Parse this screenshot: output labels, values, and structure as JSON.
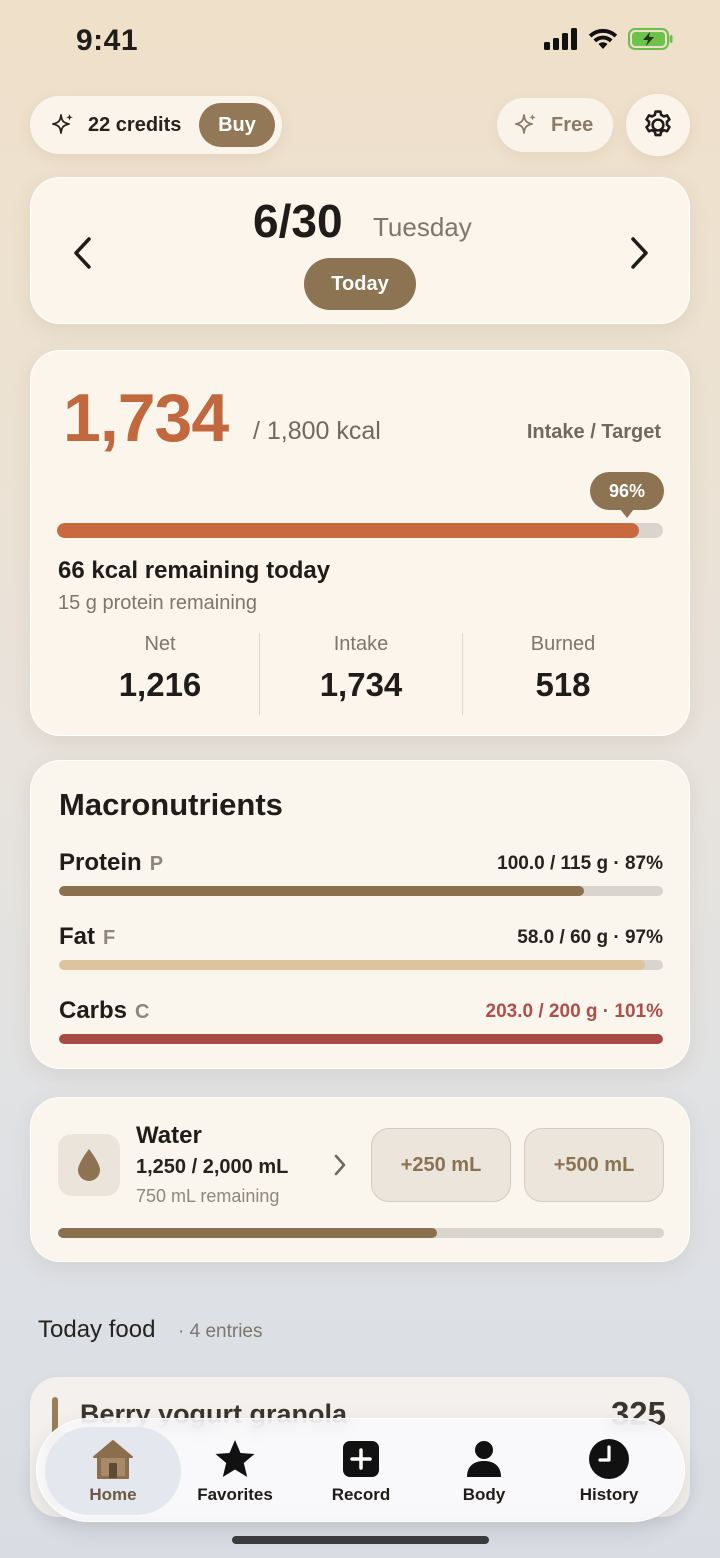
{
  "status_bar": {
    "time": "9:41"
  },
  "top": {
    "credits_label": "22 credits",
    "buy_label": "Buy",
    "plan_label": "Free"
  },
  "date": {
    "date": "6/30",
    "weekday": "Tuesday",
    "today_label": "Today"
  },
  "calories": {
    "intake": "1,734",
    "target_text": "/ 1,800 kcal",
    "caption": "Intake / Target",
    "percent_label": "96%",
    "progress": 0.96,
    "remaining_text": "66 kcal remaining today",
    "protein_remaining_text": "15 g protein remaining",
    "stats": [
      {
        "label": "Net",
        "value": "1,216"
      },
      {
        "label": "Intake",
        "value": "1,734"
      },
      {
        "label": "Burned",
        "value": "518"
      }
    ]
  },
  "macros": {
    "title": "Macronutrients",
    "items": [
      {
        "name": "Protein",
        "letter": "P",
        "values": "100.0 / 115 g · 87%",
        "progress": 0.87,
        "color": "#8b7050",
        "value_color": "#26221e"
      },
      {
        "name": "Fat",
        "letter": "F",
        "values": "58.0 / 60 g · 97%",
        "progress": 0.97,
        "color": "#dcc59d",
        "value_color": "#26221e"
      },
      {
        "name": "Carbs",
        "letter": "C",
        "values": "203.0 / 200 g · 101%",
        "progress": 1.0,
        "color": "#a84a46",
        "value_color": "#b04f49"
      }
    ]
  },
  "water": {
    "title": "Water",
    "amount": "1,250 / 2,000 mL",
    "remaining": "750 mL remaining",
    "progress": 0.625,
    "buttons": [
      "+250 mL",
      "+500 mL"
    ]
  },
  "food": {
    "heading": "Today food",
    "count": "· 4 entries",
    "first_item": {
      "name": "Berry yogurt granola",
      "kcal": "325"
    }
  },
  "tabs": [
    {
      "label": "Home",
      "icon": "home-icon",
      "active": true
    },
    {
      "label": "Favorites",
      "icon": "star-icon"
    },
    {
      "label": "Record",
      "icon": "plus-square-icon"
    },
    {
      "label": "Body",
      "icon": "person-icon"
    },
    {
      "label": "History",
      "icon": "clock-icon"
    }
  ],
  "colors": {
    "accent_brown": "#8c7352",
    "calorie_orange": "#c2683e",
    "calorie_bar": "#c8693f"
  }
}
